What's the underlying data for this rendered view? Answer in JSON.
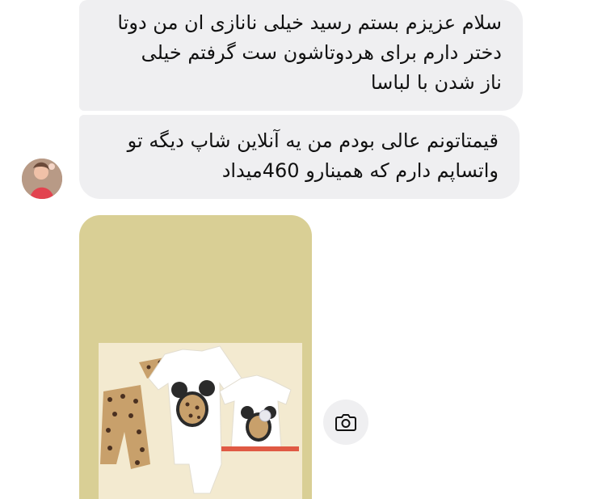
{
  "messages": [
    {
      "text": "سلام عزیزم بستم رسید خیلی نانازی ان من دوتا\nدختر دارم برای هردوتاشون ست گرفتم خیلی\nناز شدن با لباسا"
    },
    {
      "text": "قیمتاتونم عالی بودم من یه آنلاین شاپ دیگه تو\nواتساپم دارم که همینارو 460میداد"
    }
  ],
  "photo_attachment": {
    "icon": "camera-icon"
  },
  "colors": {
    "bubble_bg": "#efeff1",
    "photo_bg": "#d9cf95",
    "text": "#111111"
  }
}
